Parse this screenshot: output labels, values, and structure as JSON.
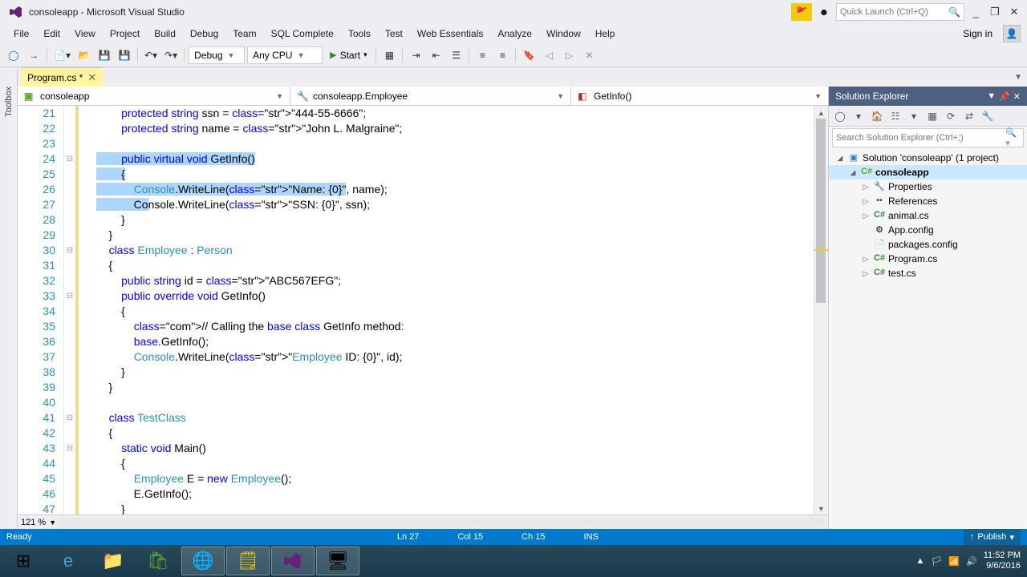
{
  "titlebar": {
    "title": "consoleapp - Microsoft Visual Studio",
    "quick_launch_placeholder": "Quick Launch (Ctrl+Q)"
  },
  "menubar": {
    "items": [
      "File",
      "Edit",
      "View",
      "Project",
      "Build",
      "Debug",
      "Team",
      "SQL Complete",
      "Tools",
      "Test",
      "Web Essentials",
      "Analyze",
      "Window",
      "Help"
    ],
    "signin": "Sign in"
  },
  "toolbar": {
    "config": "Debug",
    "platform": "Any CPU",
    "start": "Start"
  },
  "toolbox_tab": "Toolbox",
  "file_tab": {
    "name": "Program.cs *"
  },
  "nav": {
    "left": "consoleapp",
    "mid": "consoleapp.Employee",
    "right": "GetInfo()"
  },
  "zoom": "121 %",
  "status": {
    "ready": "Ready",
    "ln": "Ln 27",
    "col": "Col 15",
    "ch": "Ch 15",
    "ins": "INS",
    "publish": "Publish"
  },
  "sol": {
    "title": "Solution Explorer",
    "search_placeholder": "Search Solution Explorer (Ctrl+;)",
    "root": "Solution 'consoleapp' (1 project)",
    "project": "consoleapp",
    "nodes": [
      "Properties",
      "References",
      "animal.cs",
      "App.config",
      "packages.config",
      "Program.cs",
      "test.cs"
    ]
  },
  "code": {
    "first_line_no": 21,
    "lines": [
      {
        "t": "        protected string ssn = \"444-55-6666\";",
        "cut": true
      },
      {
        "t": "        protected string name = \"John L. Malgraine\";"
      },
      {
        "t": ""
      },
      {
        "t": "        public virtual void GetInfo()",
        "sel": true,
        "fold": true
      },
      {
        "t": "        {",
        "sel": true
      },
      {
        "t": "            Console.WriteLine(\"Name: {0}\", name);",
        "sel": true
      },
      {
        "t": "            Console.WriteLine(\"SSN: {0}\", ssn);",
        "sel_partial": "Co"
      },
      {
        "t": "        }"
      },
      {
        "t": "    }"
      },
      {
        "t": "    class Employee : Person",
        "fold": true
      },
      {
        "t": "    {"
      },
      {
        "t": "        public string id = \"ABC567EFG\";"
      },
      {
        "t": "        public override void GetInfo()",
        "fold": true
      },
      {
        "t": "        {"
      },
      {
        "t": "            // Calling the base class GetInfo method:"
      },
      {
        "t": "            base.GetInfo();"
      },
      {
        "t": "            Console.WriteLine(\"Employee ID: {0}\", id);"
      },
      {
        "t": "        }"
      },
      {
        "t": "    }"
      },
      {
        "t": ""
      },
      {
        "t": "    class TestClass",
        "fold": true
      },
      {
        "t": "    {"
      },
      {
        "t": "        static void Main()",
        "fold": true
      },
      {
        "t": "        {"
      },
      {
        "t": "            Employee E = new Employee();"
      },
      {
        "t": "            E.GetInfo();"
      },
      {
        "t": "        }"
      },
      {
        "t": "    }",
        "cutbot": true
      }
    ]
  },
  "clock": {
    "time": "11:52 PM",
    "date": "9/6/2016"
  }
}
